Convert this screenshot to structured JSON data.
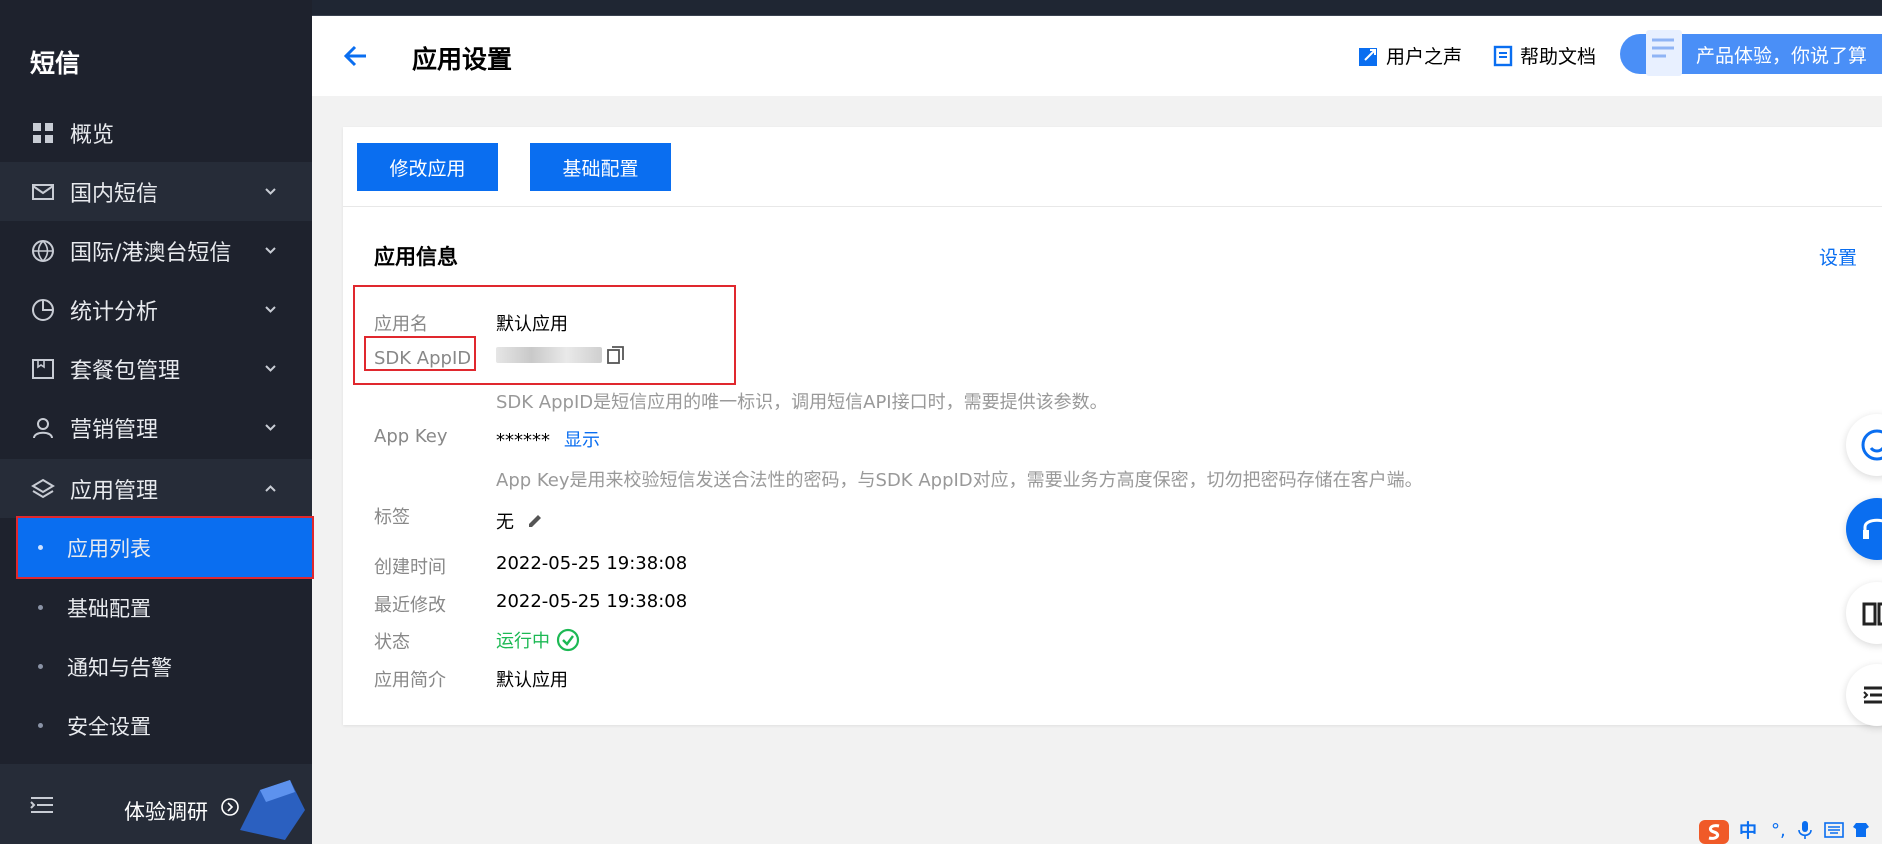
{
  "sidebar": {
    "title": "短信",
    "items": [
      {
        "label": "概览",
        "icon": "dashboard-icon"
      },
      {
        "label": "国内短信",
        "icon": "mail-icon"
      },
      {
        "label": "国际/港澳台短信",
        "icon": "globe-icon"
      },
      {
        "label": "统计分析",
        "icon": "pie-chart-icon"
      },
      {
        "label": "套餐包管理",
        "icon": "package-icon"
      },
      {
        "label": "营销管理",
        "icon": "user-icon"
      },
      {
        "label": "应用管理",
        "icon": "layers-icon"
      }
    ],
    "sub_items": [
      {
        "label": "应用列表"
      },
      {
        "label": "基础配置"
      },
      {
        "label": "通知与告警"
      },
      {
        "label": "安全设置"
      }
    ],
    "footer": {
      "label": "体验调研"
    }
  },
  "header": {
    "title": "应用设置",
    "links": {
      "feedback": "用户之声",
      "help": "帮助文档"
    },
    "promo": "产品体验，你说了算"
  },
  "toolbar": {
    "edit_app": "修改应用",
    "basic_config": "基础配置"
  },
  "app_info": {
    "section_title": "应用信息",
    "settings_link": "设置",
    "fields": {
      "name_label": "应用名",
      "name_value": "默认应用",
      "appid_label": "SDK AppID",
      "appid_hint": "SDK AppID是短信应用的唯一标识，调用短信API接口时，需要提供该参数。",
      "appkey_label": "App Key",
      "appkey_value": "******",
      "appkey_show": "显示",
      "appkey_hint": "App Key是用来校验短信发送合法性的密码，与SDK AppID对应，需要业务方高度保密，切勿把密码存储在客户端。",
      "tag_label": "标签",
      "tag_value": "无",
      "created_label": "创建时间",
      "created_value": "2022-05-25 19:38:08",
      "modified_label": "最近修改",
      "modified_value": "2022-05-25 19:38:08",
      "status_label": "状态",
      "status_value": "运行中",
      "desc_label": "应用简介",
      "desc_value": "默认应用"
    }
  },
  "ime": {
    "lang": "中"
  },
  "colors": {
    "sidebar_bg": "#1e222d",
    "accent": "#0a6ef0",
    "success": "#1db954",
    "highlight": "#e0282e"
  }
}
